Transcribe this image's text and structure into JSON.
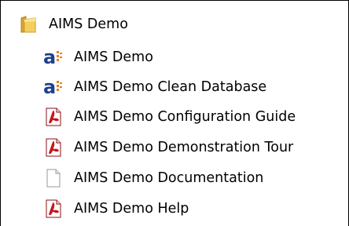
{
  "folder": {
    "label": "AIMS Demo",
    "icon": "folder-icon"
  },
  "items": [
    {
      "label": "AIMS Demo",
      "icon": "aimms-app-icon"
    },
    {
      "label": "AIMS Demo Clean Database",
      "icon": "aimms-app-icon"
    },
    {
      "label": "AIMS Demo Configuration Guide",
      "icon": "pdf-icon"
    },
    {
      "label": "AIMS Demo Demonstration Tour",
      "icon": "pdf-icon"
    },
    {
      "label": "AIMS Demo Documentation",
      "icon": "blank-document-icon"
    },
    {
      "label": "AIMS Demo Help",
      "icon": "pdf-icon"
    }
  ],
  "colors": {
    "aimms_blue": "#1f3f8f",
    "aimms_orange": "#e8801e",
    "pdf_red": "#c4161c",
    "folder_yellow": "#f2c24a"
  }
}
